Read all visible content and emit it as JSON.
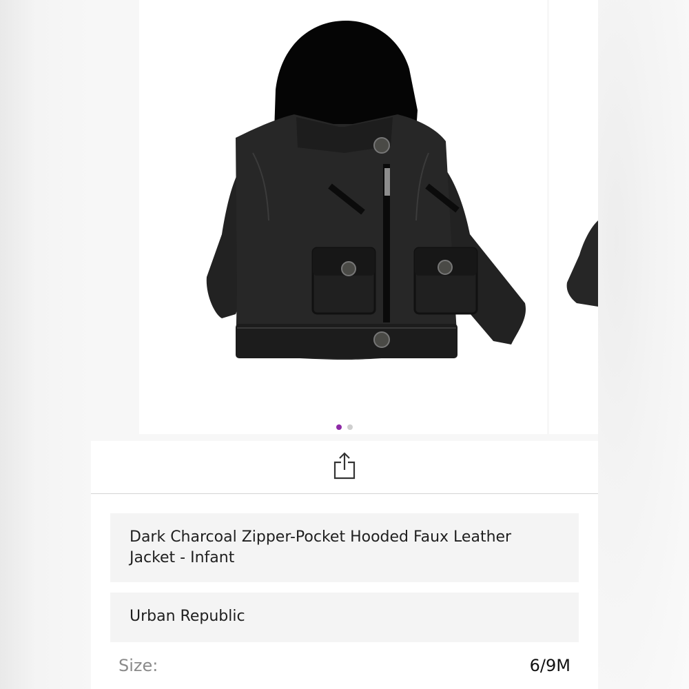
{
  "product": {
    "title": "Dark Charcoal Zipper-Pocket Hooded Faux Leather Jacket - Infant",
    "brand": "Urban Republic",
    "size_label": "Size:",
    "size_value": "6/9M"
  },
  "gallery": {
    "image_count": 2,
    "active_index": 0,
    "main_image_icon": "hooded-leather-jacket-photo"
  },
  "share": {
    "icon": "share-icon"
  },
  "colors": {
    "active_dot": "#8e2aa6",
    "inactive_dot": "#cfcfcf",
    "card_bg": "#f4f4f4",
    "jacket": "#1e1e1e"
  }
}
